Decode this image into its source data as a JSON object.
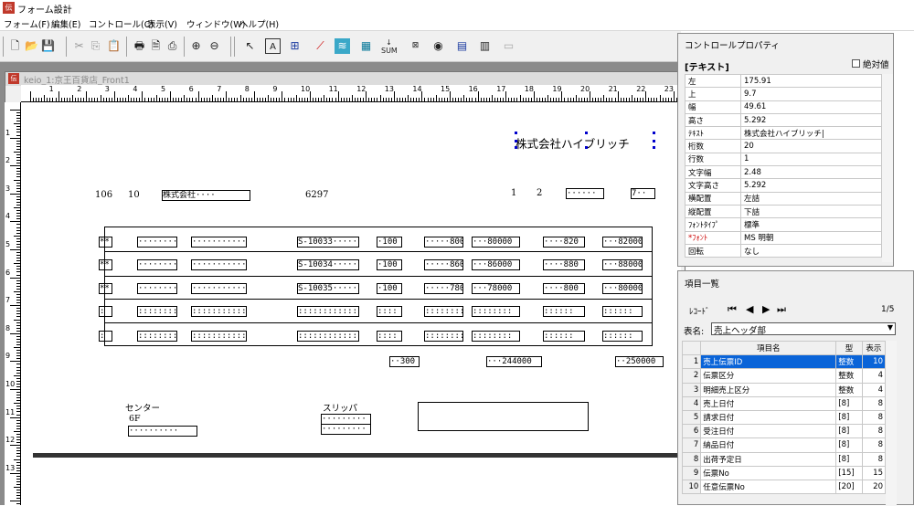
{
  "app": {
    "icon": "伝",
    "title": "フォーム設計"
  },
  "menu": [
    "フォーム(F)",
    "編集(E)",
    "コントロール(C)",
    "表示(V)",
    "ウィンドウ(W)",
    "ヘルプ(H)"
  ],
  "toolbar": [
    "new-icon",
    "open-icon",
    "save-icon",
    "cut-icon",
    "copy-icon",
    "paste-icon",
    "print-icon",
    "preview-icon",
    "print-setup-icon",
    "zoom-in-icon",
    "zoom-out-icon",
    "pointer-icon",
    "text-tool-icon",
    "field-tool-icon",
    "line-tool-icon",
    "image-tool-icon",
    "calc-tool-icon",
    "sum-tool-icon",
    "box-tool-icon",
    "circle-tool-icon",
    "table-tool-icon",
    "grid-tool-icon",
    "disabled-tool-icon"
  ],
  "toolbar_sum": "SUM",
  "document": {
    "title": "keio_1:京王百貨店_Front1"
  },
  "ruler": {
    "h": [
      "1",
      "2",
      "3",
      "4",
      "5",
      "6",
      "7",
      "8",
      "9",
      "10",
      "11",
      "12",
      "13",
      "14",
      "15",
      "16",
      "17",
      "18",
      "19",
      "20",
      "21",
      "22",
      "23"
    ],
    "v": [
      "1",
      "2",
      "3",
      "4",
      "5",
      "6",
      "7",
      "8",
      "9",
      "10",
      "11",
      "12",
      "13"
    ]
  },
  "form": {
    "company": "株式会社ハイブリッチ",
    "row1": {
      "code": "106",
      "num": "10",
      "name_box": "株式会社····",
      "phone": "6297",
      "p1": "1",
      "p2": "2",
      "box_a": "······",
      "box_b": "7··"
    },
    "detail_rows": [
      {
        "c1": "**",
        "c2": "········",
        "c3": "···········",
        "code": "S-10033·····",
        "qty": "·100",
        "price": "·····800",
        "amt": "···80000",
        "p2": "····820",
        "amt2": "···82000"
      },
      {
        "c1": "**",
        "c2": "········",
        "c3": "···········",
        "code": "S-10034·····",
        "qty": "·100",
        "price": "·····860",
        "amt": "···86000",
        "p2": "····880",
        "amt2": "···88000"
      },
      {
        "c1": "**",
        "c2": "········",
        "c3": "···········",
        "code": "S-10035·····",
        "qty": "·100",
        "price": "·····780",
        "amt": "···78000",
        "p2": "····800",
        "amt2": "···80000"
      },
      {
        "c1": ":",
        "c2": "::::::::",
        "c3": "::::::::::::",
        "code": "::::::::::::",
        "qty": "::::",
        "price": "::::::::",
        "amt": "::::::::",
        "p2": "::::::",
        "amt2": "::::::"
      },
      {
        "c1": ":",
        "c2": "::::::::",
        "c3": "::::::::::::",
        "code": "::::::::::::",
        "qty": "::::",
        "price": "::::::::",
        "amt": "::::::::",
        "p2": "::::::",
        "amt2": "::::::"
      }
    ],
    "totals": {
      "qty": "··300",
      "amt": "···244000",
      "amt2": "··250000"
    },
    "center_label": "センター",
    "center_sub": "6F",
    "center_box": "··········",
    "slipper_label": "スリッパ",
    "slipper_box1": "·········",
    "slipper_box2": "·········"
  },
  "properties": {
    "title": "コントロールプロパティ",
    "section": "[テキスト]",
    "absolute_label": "絶対値",
    "rows": [
      {
        "k": "左",
        "v": "175.91"
      },
      {
        "k": "上",
        "v": "9.7"
      },
      {
        "k": "幅",
        "v": "49.61"
      },
      {
        "k": "高さ",
        "v": "5.292"
      },
      {
        "k": "ﾃｷｽﾄ",
        "v": "株式会社ハイブリッチ|"
      },
      {
        "k": "桁数",
        "v": "20"
      },
      {
        "k": "行数",
        "v": "1"
      },
      {
        "k": "文字幅",
        "v": "2.48"
      },
      {
        "k": "文字高さ",
        "v": "5.292"
      },
      {
        "k": "横配置",
        "v": "左詰"
      },
      {
        "k": "縦配置",
        "v": "下詰"
      },
      {
        "k": "ﾌｫﾝﾄﾀｲﾌﾟ",
        "v": "標準"
      },
      {
        "k": "*ﾌｫﾝﾄ",
        "v": "MS 明朝"
      },
      {
        "k": "回転",
        "v": "なし"
      }
    ]
  },
  "items": {
    "title": "項目一覧",
    "record_label": "ﾚｺｰﾄﾞ",
    "page": "1/5",
    "table_label": "表名:",
    "table_value": "売上ヘッダ部",
    "headers": [
      "",
      "項目名",
      "型",
      "表示"
    ],
    "rows": [
      {
        "n": "1",
        "name": "売上伝票ID",
        "type": "整数",
        "size": "10"
      },
      {
        "n": "2",
        "name": "伝票区分",
        "type": "整数",
        "size": "4"
      },
      {
        "n": "3",
        "name": "明細売上区分",
        "type": "整数",
        "size": "4"
      },
      {
        "n": "4",
        "name": "売上日付",
        "type": "[8]",
        "size": "8"
      },
      {
        "n": "5",
        "name": "請求日付",
        "type": "[8]",
        "size": "8"
      },
      {
        "n": "6",
        "name": "受注日付",
        "type": "[8]",
        "size": "8"
      },
      {
        "n": "7",
        "name": "納品日付",
        "type": "[8]",
        "size": "8"
      },
      {
        "n": "8",
        "name": "出荷予定日",
        "type": "[8]",
        "size": "8"
      },
      {
        "n": "9",
        "name": "伝票No",
        "type": "[15]",
        "size": "15"
      },
      {
        "n": "10",
        "name": "任意伝票No",
        "type": "[20]",
        "size": "20"
      }
    ],
    "highlight_color": "#0a64d8"
  }
}
